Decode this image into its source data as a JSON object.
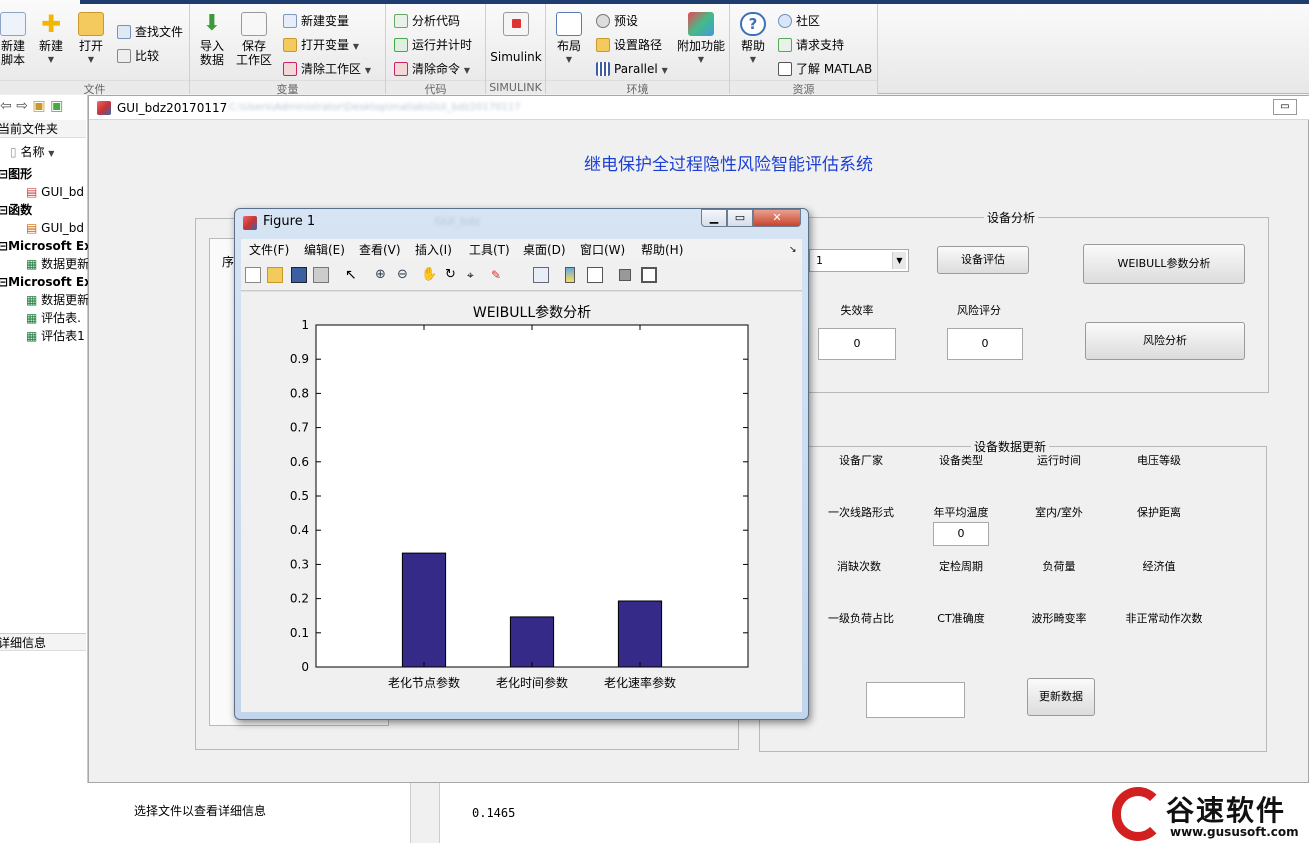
{
  "ribbon": {
    "file_group": {
      "caption": "文件",
      "new_script": "新建\n脚本",
      "new": "新建",
      "open": "打开",
      "find_files": "查找文件",
      "compare": "比较"
    },
    "variable_group": {
      "caption": "变量",
      "import_data": "导入\n数据",
      "save_workspace": "保存\n工作区",
      "new_variable": "新建变量",
      "open_variable": "打开变量",
      "clear_workspace": "清除工作区"
    },
    "code_group": {
      "caption": "代码",
      "analyze_code": "分析代码",
      "run_and_time": "运行并计时",
      "clear_commands": "清除命令"
    },
    "simulink_group": {
      "caption": "SIMULINK",
      "simulink": "Simulink"
    },
    "environment_group": {
      "caption": "环境",
      "layout": "布局",
      "preferences": "预设",
      "set_path": "设置路径",
      "parallel": "Parallel",
      "addons": "附加功能"
    },
    "resources_group": {
      "caption": "资源",
      "help": "帮助",
      "community": "社区",
      "request_support": "请求支持",
      "learn_matlab": "了解 MATLAB"
    }
  },
  "left_panel": {
    "title": "当前文件夹",
    "column_name": "名称",
    "section_figures": "图形",
    "fig_item": "GUI_bd",
    "section_functions": "函数",
    "func_item": "GUI_bd",
    "section_excel1": "Microsoft Ex",
    "excel1_item": "数据更新",
    "section_excel2": "Microsoft Ex",
    "excel2_items": [
      "数据更新",
      "评估表.",
      "评估表1"
    ],
    "details_title": "详细信息",
    "details_text": "选择文件以查看详细信息"
  },
  "gui_window": {
    "title": "GUI_bdz20170117",
    "main_title": "继电保护全过程隐性风险智能评估系统",
    "device_analysis": {
      "label": "设备分析",
      "dropdown_value": "1",
      "assess_button": "设备评估",
      "weibull_button": "WEIBULL参数分析",
      "failure_rate_label": "失效率",
      "failure_rate_value": "0",
      "risk_score_label": "风险评分",
      "risk_score_value": "0",
      "risk_button": "风险分析"
    },
    "data_update": {
      "label": "设备数据更新",
      "row1": [
        "设备厂家",
        "设备类型",
        "运行时间",
        "电压等级"
      ],
      "row2": [
        "一次线路形式",
        "年平均温度",
        "室内/室外",
        "保护距离"
      ],
      "temp_value": "0",
      "row3": [
        "消缺次数",
        "定检周期",
        "负荷量",
        "经济值"
      ],
      "row4": [
        "一级负荷占比",
        "CT准确度",
        "波形畸变率",
        "非正常动作次数"
      ],
      "update_button": "更新数据"
    },
    "left_table_header": "序"
  },
  "figure": {
    "title": "Figure 1",
    "menu": [
      "文件(F)",
      "编辑(E)",
      "查看(V)",
      "插入(I)",
      "工具(T)",
      "桌面(D)",
      "窗口(W)",
      "帮助(H)"
    ]
  },
  "chart_data": {
    "type": "bar",
    "title": "WEIBULL参数分析",
    "categories": [
      "老化节点参数",
      "老化时间参数",
      "老化速率参数"
    ],
    "values": [
      0.333,
      0.1465,
      0.193
    ],
    "ylim": [
      0,
      1
    ],
    "yticks": [
      "0",
      "0.1",
      "0.2",
      "0.3",
      "0.4",
      "0.5",
      "0.6",
      "0.7",
      "0.8",
      "0.9",
      "1"
    ],
    "bar_color": "#352a87",
    "xlabel": "",
    "ylabel": ""
  },
  "command_window": {
    "output": "0.1465"
  },
  "watermark": {
    "name": "谷速软件",
    "url": "www.gususoft.com"
  }
}
